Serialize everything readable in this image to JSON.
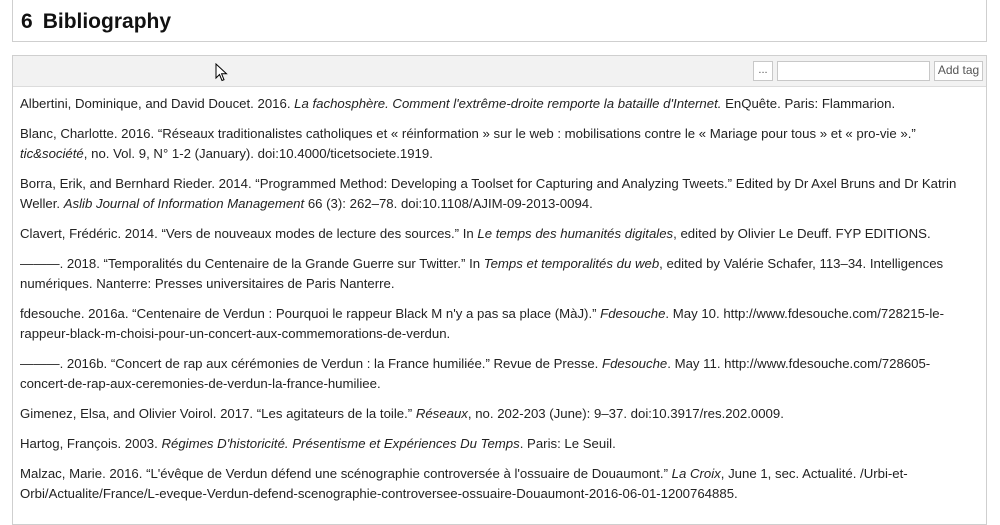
{
  "section": {
    "number": "6",
    "title": "Bibliography"
  },
  "toolbar": {
    "more_label": "...",
    "tag_input_value": "",
    "tag_input_placeholder": "",
    "add_tag_label": "Add tag"
  },
  "bibliography": [
    {
      "a": "Albertini, Dominique, and David Doucet. 2016. ",
      "i": "La fachosphère. Comment l'extrême-droite remporte la bataille d'Internet.",
      "b": " EnQuête. Paris: Flammarion."
    },
    {
      "a": "Blanc, Charlotte. 2016. “Réseaux traditionalistes catholiques et « réinformation » sur le web : mobilisations contre le « Mariage pour tous » et « pro-vie ».” ",
      "i": "tic&société",
      "b": ", no. Vol. 9, N° 1-2 (January). doi:10.4000/ticetsociete.1919."
    },
    {
      "a": "Borra, Erik, and Bernhard Rieder. 2014. “Programmed Method: Developing a Toolset for Capturing and Analyzing Tweets.” Edited by Dr Axel Bruns and Dr Katrin Weller. ",
      "i": "Aslib Journal of Information Management",
      "b": " 66 (3): 262–78. doi:10.1108/AJIM-09-2013-0094."
    },
    {
      "a": "Clavert, Frédéric. 2014. “Vers de nouveaux modes de lecture des sources.” In ",
      "i": "Le temps des humanités digitales",
      "b": ", edited by Olivier Le Deuff. FYP EDITIONS."
    },
    {
      "a": "———. 2018. “Temporalités du Centenaire de la Grande Guerre sur Twitter.” In ",
      "i": "Temps et temporalités du web",
      "b": ", edited by Valérie Schafer, 113–34. Intelligences numériques. Nanterre: Presses universitaires de Paris Nanterre."
    },
    {
      "a": "fdesouche. 2016a. “Centenaire de Verdun : Pourquoi le rappeur Black M n'y a pas sa place (MàJ).” ",
      "i": "Fdesouche",
      "b": ". May 10. http://www.fdesouche.com/728215-le-rappeur-black-m-choisi-pour-un-concert-aux-commemorations-de-verdun."
    },
    {
      "a": "———. 2016b. “Concert de rap aux cérémonies de Verdun : la France humiliée.” Revue de Presse. ",
      "i": "Fdesouche",
      "b": ". May 11. http://www.fdesouche.com/728605-concert-de-rap-aux-ceremonies-de-verdun-la-france-humiliee."
    },
    {
      "a": "Gimenez, Elsa, and Olivier Voirol. 2017. “Les agitateurs de la toile.” ",
      "i": "Réseaux",
      "b": ", no. 202-203 (June): 9–37. doi:10.3917/res.202.0009."
    },
    {
      "a": "Hartog, François. 2003. ",
      "i": "Régimes D'historicité. Présentisme et Expériences Du Temps",
      "b": ". Paris: Le Seuil."
    },
    {
      "a": "Malzac, Marie. 2016. “L'évêque de Verdun défend une scénographie controversée à l'ossuaire de Douaumont.” ",
      "i": "La Croix",
      "b": ", June 1, sec. Actualité. /Urbi-et-Orbi/Actualite/France/L-eveque-Verdun-defend-scenographie-controversee-ossuaire-Douaumont-2016-06-01-1200764885."
    }
  ]
}
